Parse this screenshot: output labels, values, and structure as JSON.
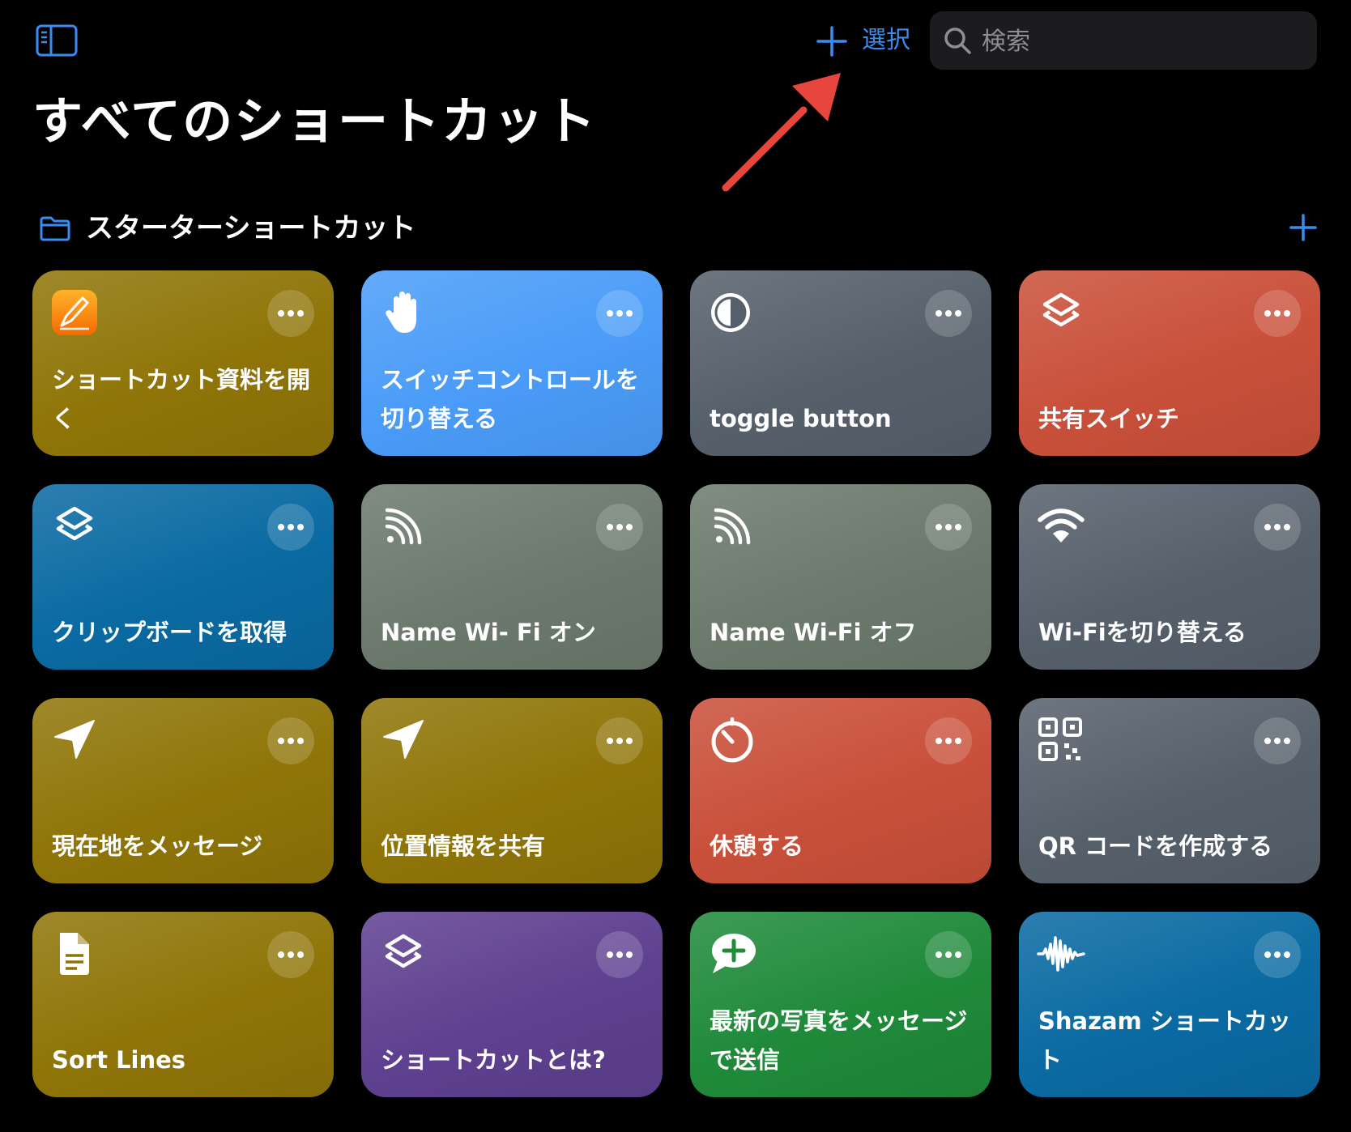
{
  "header": {
    "select_label": "選択",
    "search_placeholder": "検索",
    "page_title": "すべてのショートカット"
  },
  "folder": {
    "title": "スターターショートカット"
  },
  "colors": {
    "accent": "#3a8cf2",
    "annotation_arrow": "#e8453c"
  },
  "tiles": [
    {
      "label": "ショートカット資料を開く",
      "icon": "pages-app-icon",
      "color": "#8f7508"
    },
    {
      "label": "スイッチコントロールを切り替える",
      "icon": "hand-raised-icon",
      "color": "#4a9cf8"
    },
    {
      "label": "toggle button",
      "icon": "circle-half-icon",
      "color": "#56606b"
    },
    {
      "label": "共有スイッチ",
      "icon": "shortcuts-layers-icon",
      "color": "#c9503a"
    },
    {
      "label": "クリップボードを取得",
      "icon": "shortcuts-layers-icon",
      "color": "#0a6aa2"
    },
    {
      "label": "Name Wi- Fi オン",
      "icon": "rss-feed-icon",
      "color": "#6b7a6c"
    },
    {
      "label": "Name Wi-Fi オフ",
      "icon": "rss-feed-icon",
      "color": "#6b7a6c"
    },
    {
      "label": "Wi-Fiを切り替える",
      "icon": "wifi-icon",
      "color": "#56606b"
    },
    {
      "label": "現在地をメッセージ",
      "icon": "location-arrow-icon",
      "color": "#8f7508"
    },
    {
      "label": "位置情報を共有",
      "icon": "location-arrow-icon",
      "color": "#8f7508"
    },
    {
      "label": "休憩する",
      "icon": "timer-icon",
      "color": "#c9503a"
    },
    {
      "label": "QR コードを作成する",
      "icon": "qr-code-icon",
      "color": "#56606b"
    },
    {
      "label": "Sort Lines",
      "icon": "document-icon",
      "color": "#8f7508"
    },
    {
      "label": "ショートカットとは?",
      "icon": "shortcuts-layers-icon",
      "color": "#5e4090"
    },
    {
      "label": "最新の写真をメッセージで送信",
      "icon": "message-plus-icon",
      "color": "#1f8a3a"
    },
    {
      "label": "Shazam ショートカット",
      "icon": "waveform-icon",
      "color": "#0a6aa2"
    }
  ]
}
